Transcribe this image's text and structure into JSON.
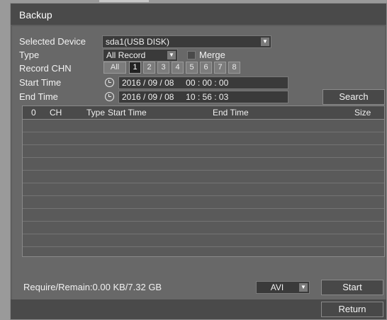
{
  "window": {
    "title": "Backup"
  },
  "selected_device": {
    "label": "Selected Device",
    "value": "sda1(USB DISK)"
  },
  "type": {
    "label": "Type",
    "value": "All Record",
    "merge_label": "Merge"
  },
  "record_chn": {
    "label": "Record CHN",
    "all_label": "All",
    "channels": [
      "1",
      "2",
      "3",
      "4",
      "5",
      "6",
      "7",
      "8"
    ],
    "selected": "1"
  },
  "start_time": {
    "label": "Start Time",
    "year": "2016",
    "month": "09",
    "day": "08",
    "hh": "00",
    "mm": "00",
    "ss": "00"
  },
  "end_time": {
    "label": "End Time",
    "year": "2016",
    "month": "09",
    "day": "08",
    "hh": "10",
    "mm": "56",
    "ss": "03"
  },
  "search_label": "Search",
  "table": {
    "columns": [
      "0",
      "CH",
      "Type",
      "Start Time",
      "End Time",
      "Size"
    ]
  },
  "require_remain": "Require/Remain:0.00 KB/7.32 GB",
  "format": {
    "value": "AVI"
  },
  "start_label": "Start",
  "return_label": "Return",
  "colors": {
    "window_bg": "#5e5e5e",
    "title_bar": "#4a4a4a",
    "field_bg": "#3a3a3a",
    "selected_channel": "#222222"
  }
}
